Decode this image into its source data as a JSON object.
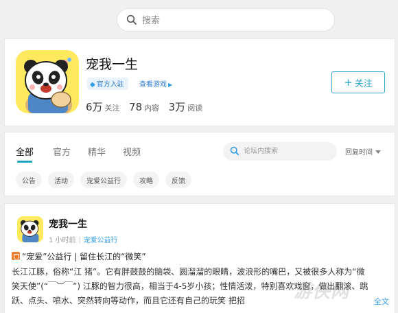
{
  "search": {
    "placeholder": "搜索"
  },
  "profile": {
    "name": "宠我一生",
    "official_badge": "官方入驻",
    "view_game_label": "查看游戏",
    "follow_label": "关注",
    "stats": [
      {
        "value": "6万",
        "label": "关注"
      },
      {
        "value": "78",
        "label": "内容"
      },
      {
        "value": "3万",
        "label": "阅读"
      }
    ]
  },
  "tabs": [
    {
      "label": "全部",
      "active": true
    },
    {
      "label": "官方"
    },
    {
      "label": "精华"
    },
    {
      "label": "视频"
    }
  ],
  "forum_search": {
    "placeholder": "论坛内搜索"
  },
  "sort": {
    "label": "回复时间"
  },
  "categories": [
    "公告",
    "活动",
    "宠爱公益行",
    "攻略",
    "反馈"
  ],
  "post": {
    "author": "宠我一生",
    "time": "1 小时前",
    "category": "宠爱公益行",
    "title": "“宠爱”公益行 | 留住长江的“微笑”",
    "body": "长江江豚，俗称“江 猪”。它有胖鼓鼓的脑袋、圆溜溜的眼睛，波浪形的嘴巴，又被很多人称为“微笑天使”(“￣︶￣”) 江豚的智力很高，相当于4-5岁小孩；性情活泼，特别喜欢戏窗，做出翻滚、跳跃、点头、喷水、突然转向等动作，而且它还有自己的玩笑 把招",
    "expand_label": "全文"
  },
  "watermark": "游侠网",
  "colors": {
    "accent": "#1fa0c6",
    "link": "#2d9de6",
    "tag": "#f07b2e"
  },
  "icons": {
    "search": "search-icon",
    "avatar": "panda-avatar",
    "badge": "verified-icon",
    "caret": "chevron-down-icon"
  }
}
